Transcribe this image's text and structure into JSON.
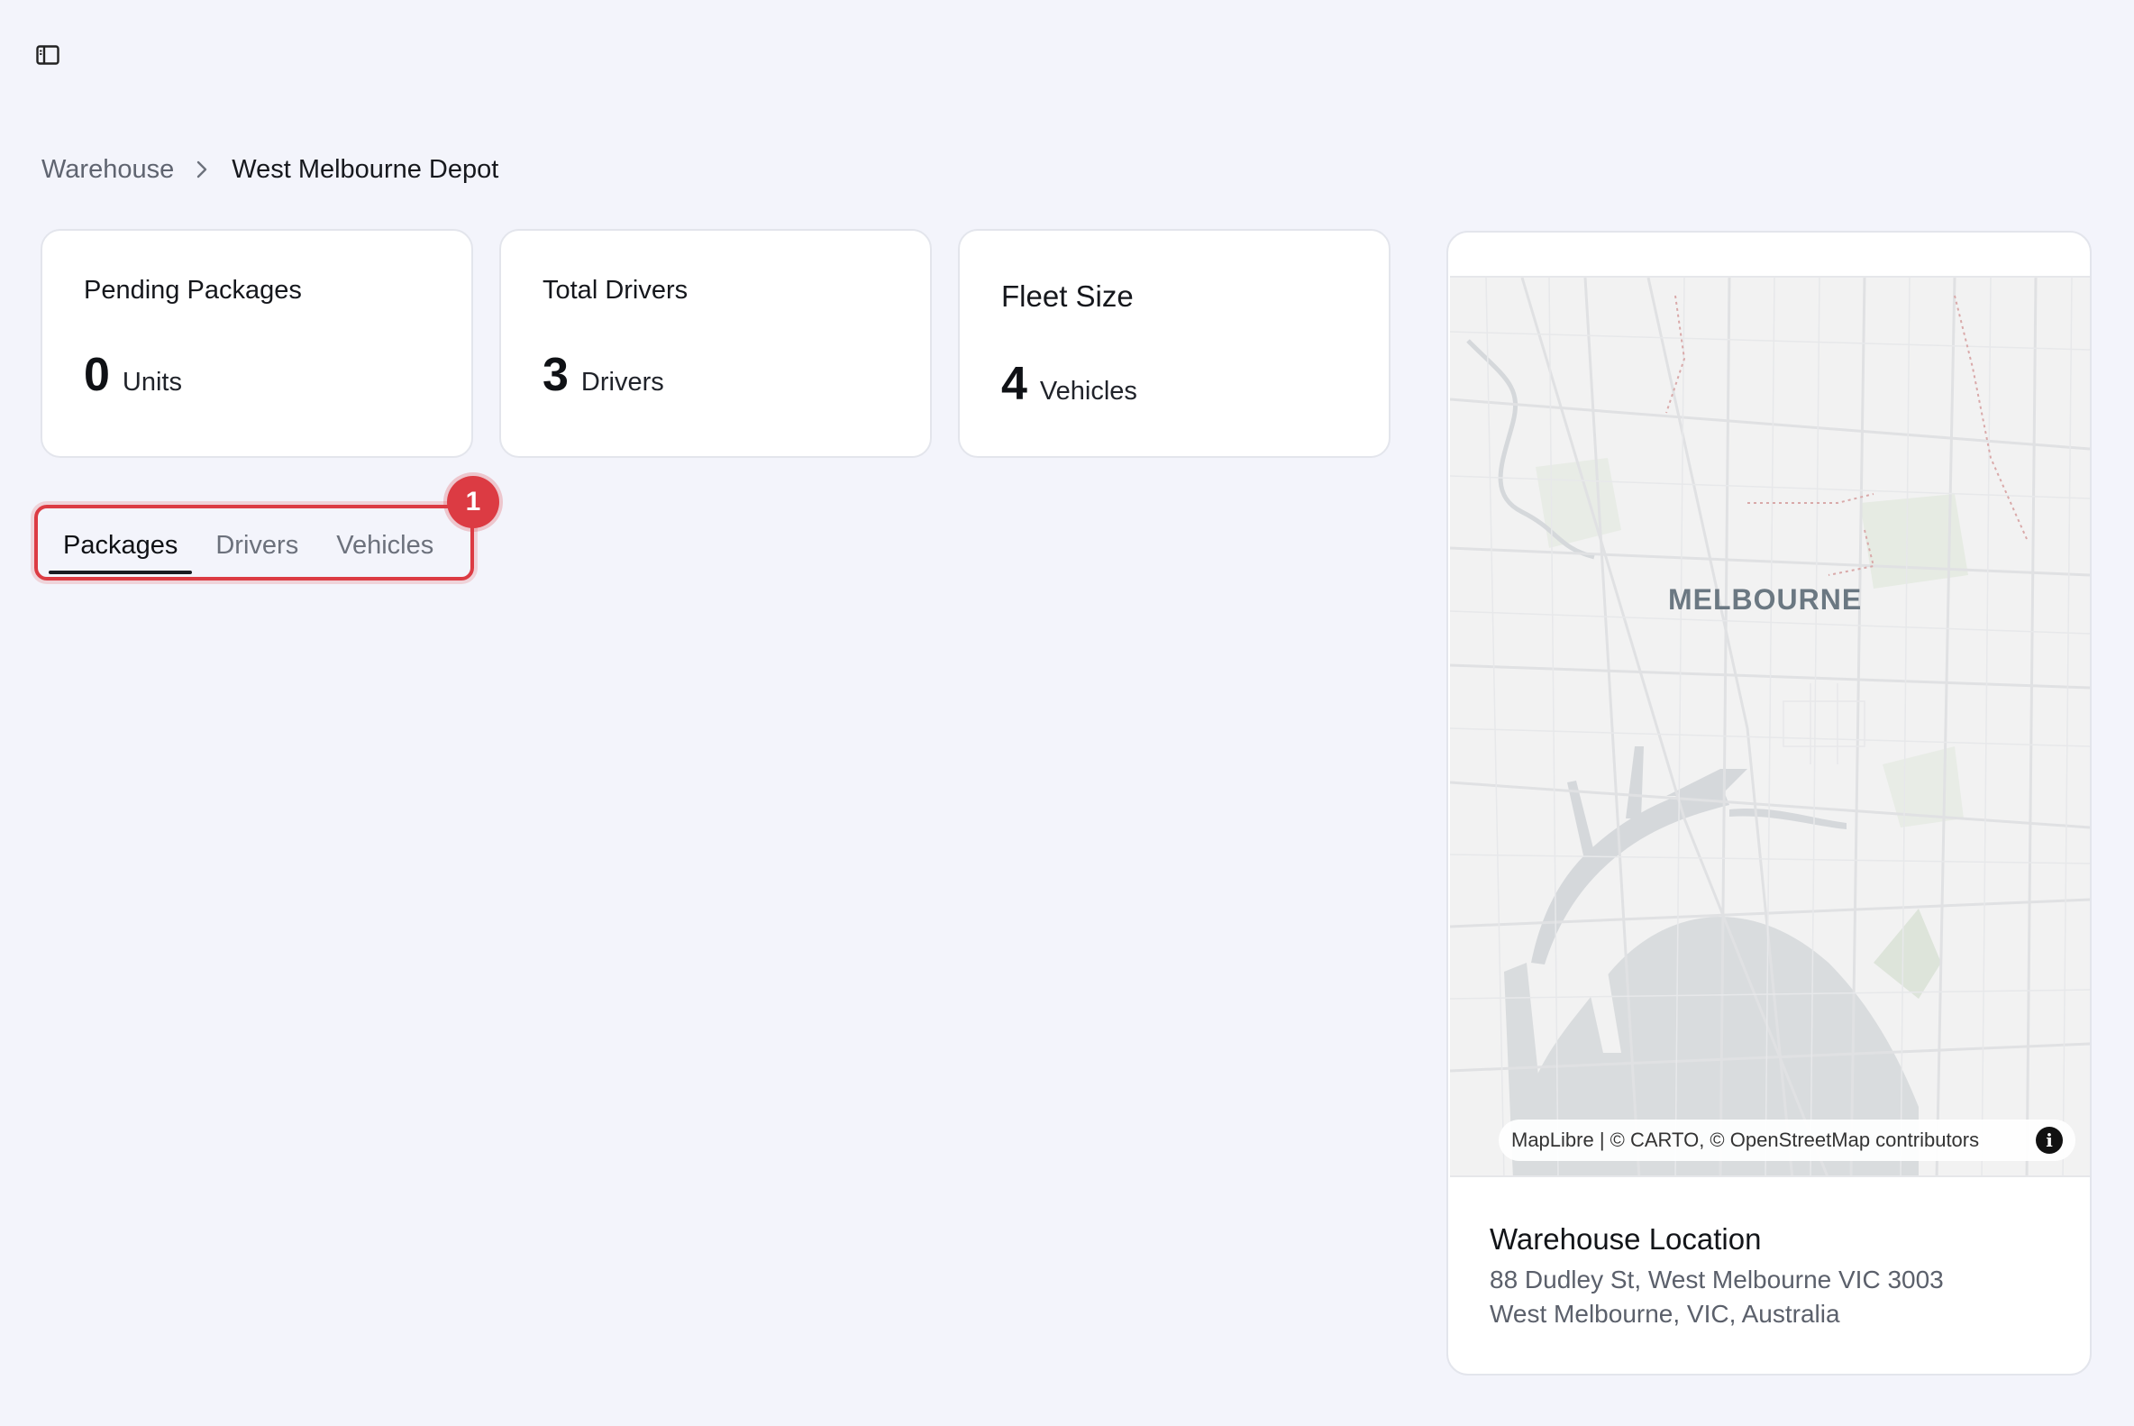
{
  "header": {
    "sidebar_toggle_icon": "sidebar-toggle-icon"
  },
  "breadcrumb": {
    "parent": "Warehouse",
    "separator_icon": "chevron-right-icon",
    "current": "West Melbourne Depot"
  },
  "stats": [
    {
      "title": "Pending Packages",
      "value": "0",
      "unit": "Units"
    },
    {
      "title": "Total Drivers",
      "value": "3",
      "unit": "Drivers"
    },
    {
      "title": "Fleet Size",
      "value": "4",
      "unit": "Vehicles"
    }
  ],
  "tabs": [
    {
      "label": "Packages",
      "active": true
    },
    {
      "label": "Drivers",
      "active": false
    },
    {
      "label": "Vehicles",
      "active": false
    }
  ],
  "annotation": {
    "marker": "1",
    "color": "#dc3b43"
  },
  "map": {
    "city_label": "MELBOURNE",
    "attribution": {
      "maplibre": "MapLibre",
      "sep": " | ",
      "carto": "© CARTO, © OpenStreetMap",
      "contributors": " contributors"
    },
    "info_icon": "i"
  },
  "location": {
    "title": "Warehouse Location",
    "address_line1": "88 Dudley St, West Melbourne VIC 3003",
    "address_line2": "West Melbourne, VIC, Australia"
  }
}
